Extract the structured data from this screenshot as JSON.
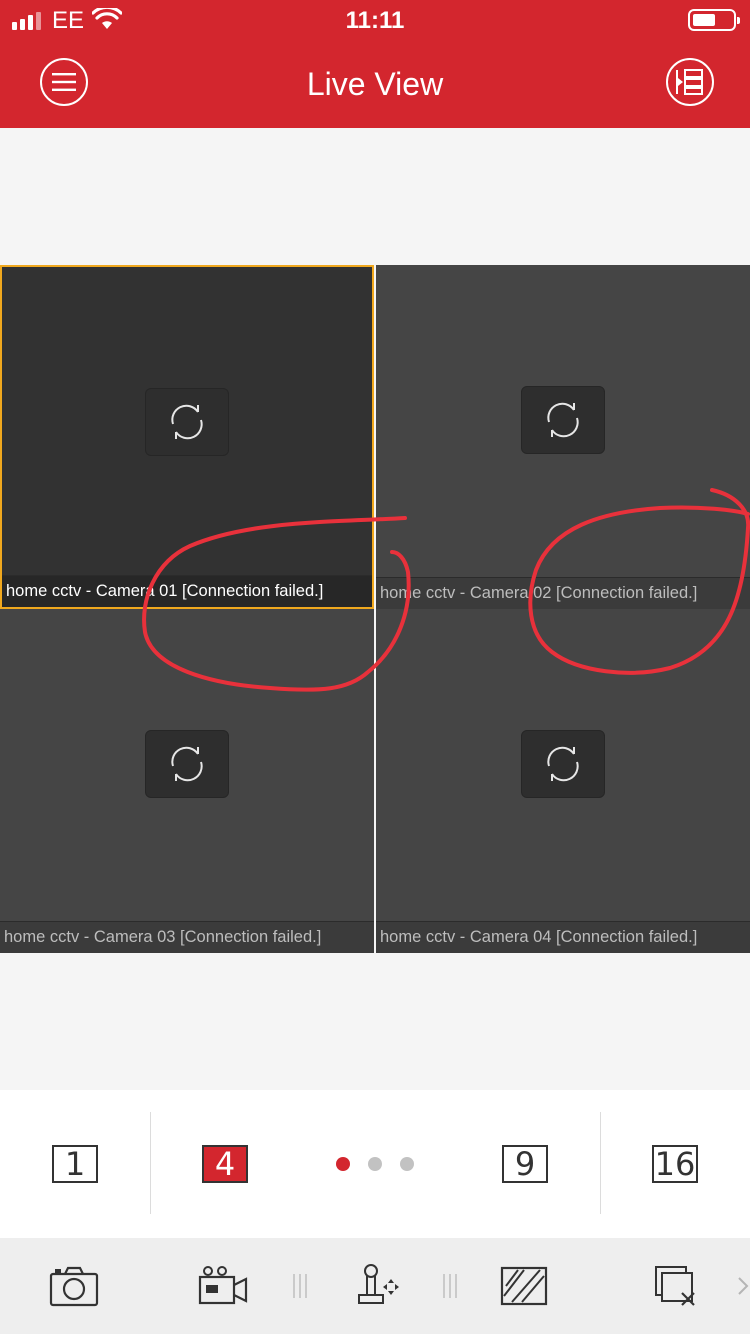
{
  "status_bar": {
    "carrier": "EE",
    "time": "11:11"
  },
  "header": {
    "title": "Live View",
    "menu_icon": "hamburger-menu-icon",
    "device_list_icon": "device-list-icon"
  },
  "cameras": [
    {
      "label": "home cctv - Camera 01 [Connection failed.]",
      "selected": true
    },
    {
      "label": "home cctv - Camera 02 [Connection failed.]",
      "selected": false
    },
    {
      "label": "home cctv - Camera 03 [Connection failed.]",
      "selected": false
    },
    {
      "label": "home cctv - Camera 04 [Connection failed.]",
      "selected": false
    }
  ],
  "layout_selector": {
    "options": [
      "1",
      "4",
      "9",
      "16"
    ],
    "selected": "4",
    "pages": 3,
    "current_page": 1
  },
  "toolbar": {
    "items": [
      "capture-icon",
      "record-icon",
      "ptz-icon",
      "image-quality-icon",
      "stop-all-icon"
    ]
  },
  "colors": {
    "brand_red": "#d3262e",
    "selected_border": "#f0a81e",
    "annotation": "#e8313b"
  }
}
